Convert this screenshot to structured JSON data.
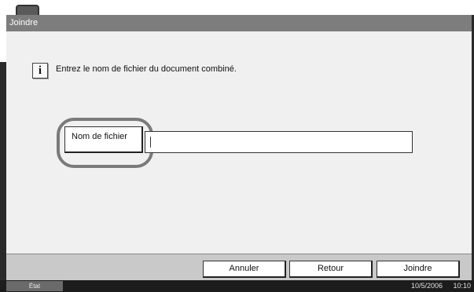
{
  "window": {
    "title": "Joindre"
  },
  "message": {
    "icon": "info-icon",
    "icon_glyph": "i",
    "text": "Entrez le nom de fichier du document combiné."
  },
  "filename": {
    "button_label": "Nom de fichier",
    "input_value": ""
  },
  "buttons": {
    "cancel": "Annuler",
    "back": "Retour",
    "join": "Joindre"
  },
  "status": {
    "label": "État",
    "date": "10/5/2006",
    "time": "10:10"
  }
}
